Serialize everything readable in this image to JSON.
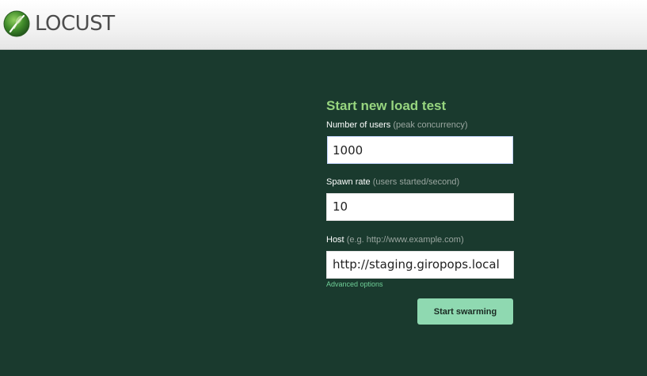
{
  "app": {
    "logo_text": "LOCUST"
  },
  "form": {
    "title": "Start new load test",
    "users": {
      "label": "Number of users",
      "hint": "(peak concurrency)",
      "value": "1000"
    },
    "spawn_rate": {
      "label": "Spawn rate",
      "hint": "(users started/second)",
      "value": "10"
    },
    "host": {
      "label": "Host",
      "hint": "(e.g. http://www.example.com)",
      "value": "http://staging.giropops.local"
    },
    "advanced_link": "Advanced options",
    "submit_label": "Start swarming"
  },
  "colors": {
    "background": "#1a3a2e",
    "title_green": "#97d57f",
    "button": "#8fd9b1",
    "link": "#6fcf97"
  },
  "icons": {
    "logo": "locust-logo-icon"
  }
}
